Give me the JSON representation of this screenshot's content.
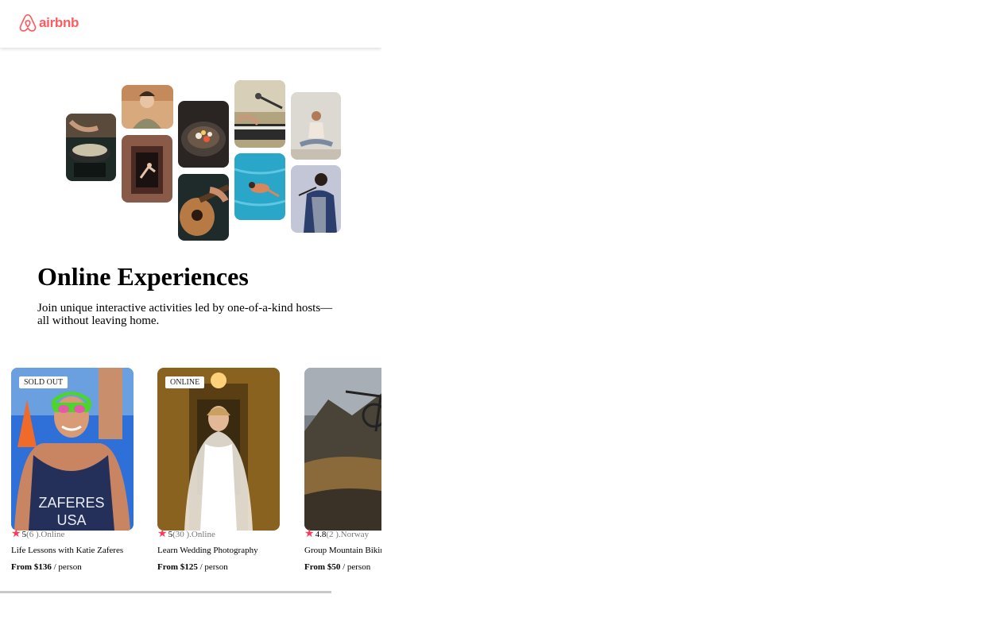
{
  "brand": {
    "name": "airbnb",
    "color": "#ff5a5f"
  },
  "hero": {
    "title": "Online Experiences",
    "subtitle": "Join unique interactive activities led by one-of-a-kind hosts—all without leaving home."
  },
  "collage": [
    {
      "subject": "cooking pot"
    },
    {
      "subject": "woman portrait"
    },
    {
      "subject": "dancer in doorway"
    },
    {
      "subject": "food bowl"
    },
    {
      "subject": "guitar"
    },
    {
      "subject": "microphone and keyboard"
    },
    {
      "subject": "swimmer"
    },
    {
      "subject": "yoga"
    },
    {
      "subject": "singer"
    }
  ],
  "cards": [
    {
      "badge": "SOLD OUT",
      "rating": "5",
      "reviews": "(6 )",
      "location": ".Online",
      "title": "Life Lessons with Katie Zaferes",
      "price": "From $136",
      "per": " / person"
    },
    {
      "badge": "ONLINE",
      "rating": "5",
      "reviews": "(30 )",
      "location": ".Online",
      "title": "Learn Wedding Photography",
      "price": "From $125",
      "per": " / person"
    },
    {
      "badge": "",
      "rating": "4.8",
      "reviews": "(2 )",
      "location": ".Norway",
      "title": "Group Mountain Biking",
      "price": "From $50",
      "per": " / person"
    }
  ],
  "colors": {
    "star": "#fe385c",
    "scrollbar": "#c9c9c9"
  }
}
